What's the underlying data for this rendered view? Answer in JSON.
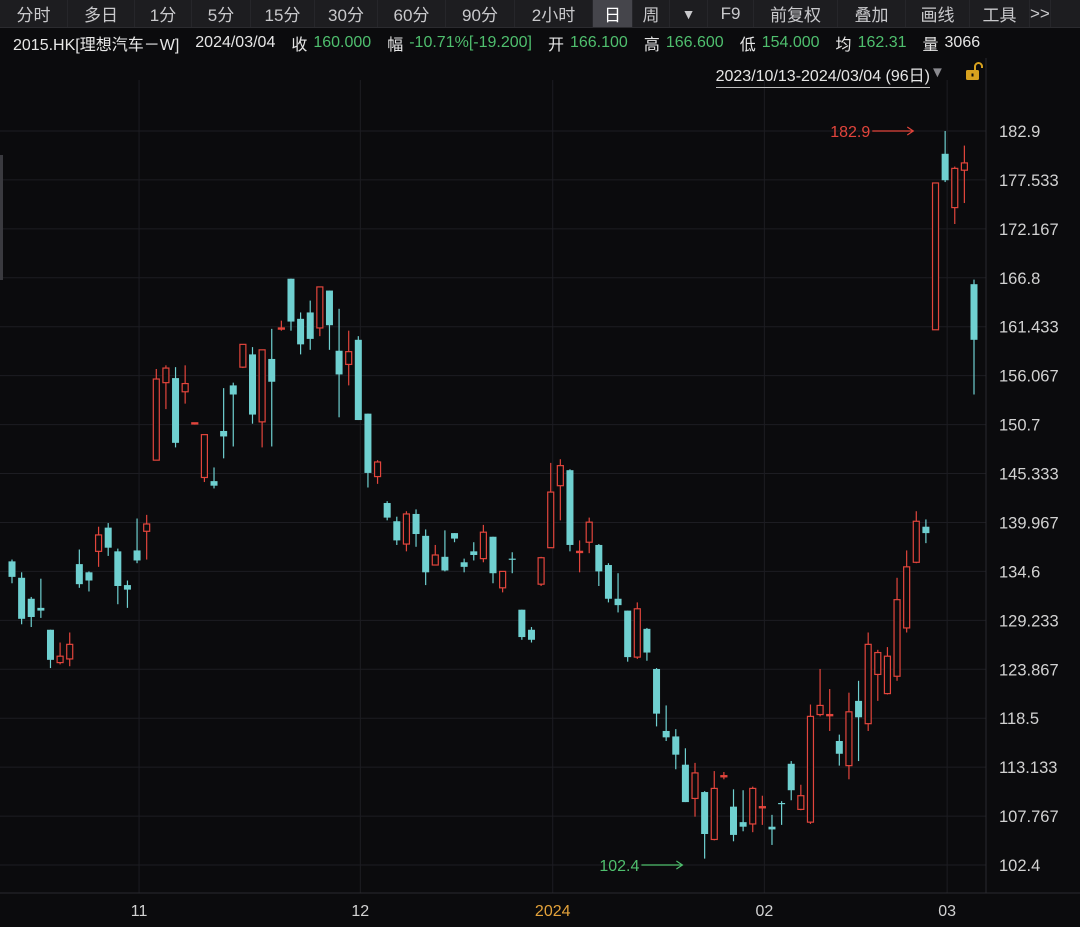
{
  "toolbar": {
    "items": [
      "分时",
      "多日",
      "1分",
      "5分",
      "15分",
      "30分",
      "60分",
      "90分",
      "2小时",
      "日",
      "周",
      "F9",
      "前复权",
      "叠加",
      "画线",
      "工具",
      ">>"
    ],
    "active": "日"
  },
  "quote": {
    "symbol": "2015.HK[理想汽车－W]",
    "date": "2024/03/04",
    "close_label": "收",
    "close": "160.000",
    "change_label": "幅",
    "change": "-10.71%[-19.200]",
    "open_label": "开",
    "open": "166.100",
    "high_label": "高",
    "high": "166.600",
    "low_label": "低",
    "low": "154.000",
    "avg_label": "均",
    "avg": "162.31",
    "volume_label": "量",
    "volume": "3066"
  },
  "range": {
    "label": "2023/10/13-2024/03/04 (96日)"
  },
  "icons": {
    "range_dropdown": "triangle-down-icon",
    "lock": "unlock-icon"
  },
  "colors": {
    "up": "#e2453c",
    "down": "#6fd0d0",
    "grid": "#1d1d22",
    "background": "#0b0b0d",
    "year_label": "#e3a23a"
  },
  "chart_data": {
    "type": "candlestick",
    "y_ticks": [
      "182.9",
      "177.533",
      "172.167",
      "166.8",
      "161.433",
      "156.067",
      "150.7",
      "145.333",
      "139.967",
      "134.6",
      "129.233",
      "123.867",
      "118.5",
      "113.133",
      "107.767",
      "102.4"
    ],
    "ylim": [
      99.4,
      188.6
    ],
    "x_ticks": [
      {
        "label": "11",
        "index": 13
      },
      {
        "label": "12",
        "index": 36
      },
      {
        "label": "2024",
        "index": 56
      },
      {
        "label": "02",
        "index": 78
      },
      {
        "label": "03",
        "index": 97
      }
    ],
    "annotations": [
      {
        "label": "182.9",
        "value": 182.9,
        "index": 94,
        "kind": "high"
      },
      {
        "label": "102.4",
        "value": 102.4,
        "index": 70,
        "kind": "low"
      }
    ],
    "grid": true,
    "candles": [
      [
        135.7,
        134.0,
        135.9,
        133.3
      ],
      [
        133.9,
        129.4,
        134.5,
        128.8
      ],
      [
        131.6,
        129.6,
        131.8,
        128.5
      ],
      [
        130.6,
        130.3,
        133.8,
        129.5
      ],
      [
        128.2,
        124.9,
        128.2,
        124.0
      ],
      [
        124.6,
        125.3,
        126.8,
        124.4
      ],
      [
        125.0,
        126.6,
        127.9,
        124.2
      ],
      [
        135.4,
        133.2,
        137.0,
        132.8
      ],
      [
        134.5,
        133.6,
        134.6,
        132.4
      ],
      [
        136.8,
        138.6,
        139.5,
        135.1
      ],
      [
        139.4,
        137.2,
        139.9,
        136.3
      ],
      [
        136.8,
        133.0,
        137.1,
        131.0
      ],
      [
        133.1,
        132.6,
        133.6,
        130.6
      ],
      [
        136.9,
        135.8,
        140.4,
        135.5
      ],
      [
        139.0,
        139.8,
        140.8,
        135.9
      ],
      [
        146.8,
        155.7,
        156.8,
        146.8
      ],
      [
        155.3,
        156.9,
        157.2,
        152.4
      ],
      [
        155.8,
        148.7,
        157.0,
        148.2
      ],
      [
        154.3,
        155.2,
        157.2,
        153.0
      ],
      [
        150.8,
        150.9,
        150.9,
        150.7
      ],
      [
        144.9,
        149.6,
        149.6,
        144.4
      ],
      [
        144.5,
        144.0,
        146.0,
        143.7
      ],
      [
        150.0,
        149.4,
        154.7,
        147.0
      ],
      [
        155.0,
        154.0,
        155.3,
        148.3
      ],
      [
        157.0,
        159.5,
        159.5,
        156.9
      ],
      [
        158.4,
        151.8,
        159.2,
        150.8
      ],
      [
        151.0,
        158.9,
        158.9,
        148.2
      ],
      [
        157.9,
        155.4,
        161.2,
        148.3
      ],
      [
        161.3,
        161.3,
        162.1,
        161.0
      ],
      [
        166.7,
        162.0,
        166.7,
        161.0
      ],
      [
        162.3,
        159.5,
        163.0,
        158.4
      ],
      [
        163.0,
        160.1,
        164.3,
        158.9
      ],
      [
        161.3,
        165.8,
        165.8,
        160.4
      ],
      [
        165.4,
        161.6,
        165.4,
        158.9
      ],
      [
        158.8,
        156.2,
        163.4,
        151.5
      ],
      [
        157.3,
        158.7,
        161.0,
        155.0
      ],
      [
        160.0,
        151.2,
        160.4,
        151.2
      ],
      [
        151.9,
        145.4,
        151.9,
        143.8
      ],
      [
        145.0,
        146.6,
        146.8,
        144.2
      ],
      [
        142.1,
        140.5,
        142.3,
        140.2
      ],
      [
        140.1,
        138.0,
        140.6,
        137.5
      ],
      [
        137.6,
        140.9,
        141.2,
        136.8
      ],
      [
        140.9,
        138.7,
        141.4,
        137.3
      ],
      [
        138.5,
        134.5,
        139.2,
        133.1
      ],
      [
        135.3,
        136.4,
        137.5,
        135.5
      ],
      [
        136.2,
        134.7,
        139.1,
        134.6
      ],
      [
        138.8,
        138.2,
        138.8,
        137.8
      ],
      [
        135.6,
        135.1,
        136.0,
        134.5
      ],
      [
        136.8,
        136.4,
        137.8,
        135.8
      ],
      [
        136.0,
        138.9,
        139.7,
        135.6
      ],
      [
        138.4,
        134.4,
        138.4,
        133.3
      ],
      [
        132.8,
        134.6,
        134.6,
        132.3
      ],
      [
        136.0,
        135.9,
        136.7,
        134.4
      ],
      [
        130.4,
        127.4,
        130.4,
        127.1
      ],
      [
        128.2,
        127.1,
        128.5,
        126.8
      ],
      [
        133.2,
        136.1,
        136.2,
        133.0
      ],
      [
        137.2,
        143.3,
        146.5,
        137.2
      ],
      [
        144.0,
        146.2,
        146.9,
        140.2
      ],
      [
        145.7,
        137.5,
        145.8,
        136.8
      ],
      [
        136.8,
        136.8,
        138.0,
        134.5
      ],
      [
        137.8,
        140.0,
        140.5,
        136.6
      ],
      [
        137.5,
        134.6,
        137.6,
        133.0
      ],
      [
        135.3,
        131.6,
        135.5,
        131.2
      ],
      [
        131.6,
        130.9,
        134.4,
        130.1
      ],
      [
        130.3,
        125.2,
        130.3,
        124.7
      ],
      [
        125.2,
        130.5,
        131.2,
        125.0
      ],
      [
        128.3,
        125.7,
        128.4,
        124.8
      ],
      [
        123.9,
        119.0,
        124.0,
        117.6
      ],
      [
        117.1,
        116.4,
        119.9,
        116.0
      ],
      [
        116.5,
        114.5,
        117.3,
        112.9
      ],
      [
        113.4,
        109.3,
        115.2,
        109.3
      ],
      [
        109.7,
        112.5,
        113.6,
        107.7
      ],
      [
        110.4,
        105.8,
        110.5,
        103.1
      ],
      [
        105.2,
        110.8,
        112.7,
        105.1
      ],
      [
        112.2,
        112.2,
        112.6,
        111.8
      ],
      [
        108.8,
        105.7,
        110.7,
        105.0
      ],
      [
        107.1,
        106.6,
        110.6,
        106.1
      ],
      [
        106.9,
        110.8,
        111.0,
        106.0
      ],
      [
        108.7,
        108.8,
        110.0,
        106.8
      ],
      [
        106.6,
        106.3,
        107.9,
        104.6
      ],
      [
        109.2,
        109.1,
        109.4,
        106.8
      ],
      [
        113.5,
        110.6,
        113.8,
        109.5
      ],
      [
        108.5,
        110.0,
        111.2,
        108.4
      ],
      [
        107.1,
        118.7,
        120.0,
        106.9
      ],
      [
        118.9,
        119.9,
        123.9,
        118.7
      ],
      [
        118.8,
        118.9,
        121.7,
        117.1
      ],
      [
        116.0,
        114.6,
        116.7,
        113.3
      ],
      [
        113.3,
        119.2,
        121.3,
        111.8
      ],
      [
        120.4,
        118.6,
        122.6,
        113.8
      ],
      [
        117.9,
        126.6,
        127.9,
        117.1
      ],
      [
        123.3,
        125.7,
        126.0,
        120.4
      ],
      [
        121.2,
        125.3,
        126.3,
        121.1
      ],
      [
        123.1,
        131.5,
        133.9,
        122.6
      ],
      [
        128.4,
        135.1,
        136.9,
        127.9
      ],
      [
        135.6,
        140.1,
        141.2,
        135.5
      ],
      [
        139.5,
        138.8,
        140.3,
        137.7
      ],
      [
        161.1,
        177.2,
        177.2,
        161.1
      ],
      [
        180.4,
        177.5,
        182.9,
        177.3
      ],
      [
        174.5,
        178.8,
        179.0,
        172.7
      ],
      [
        178.6,
        179.4,
        181.3,
        175.0
      ],
      [
        166.1,
        160.0,
        166.6,
        154.0
      ]
    ]
  }
}
